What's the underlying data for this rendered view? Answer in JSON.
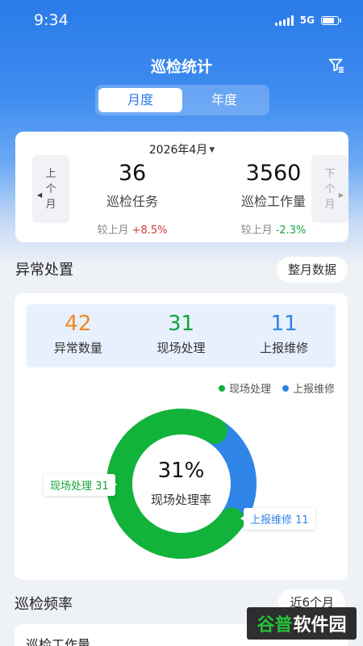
{
  "status": {
    "time": "9:34",
    "network": "5G"
  },
  "header": {
    "title": "巡检统计"
  },
  "segments": [
    {
      "label": "月度"
    },
    {
      "label": "年度"
    }
  ],
  "summary": {
    "month": "2026年4月",
    "prev_label": [
      "上",
      "个",
      "月"
    ],
    "next_label": [
      "下",
      "个",
      "月"
    ],
    "stats": [
      {
        "value": "36",
        "label": "巡检任务",
        "compare_label": "较上月",
        "delta": "+8.5%"
      },
      {
        "value": "3560",
        "label": "巡检工作量",
        "compare_label": "较上月",
        "delta": "-2.3%"
      }
    ]
  },
  "anomaly": {
    "title": "异常处置",
    "range_button": "整月数据",
    "metrics": [
      {
        "value": "42",
        "label": "异常数量",
        "color": "#f08a24"
      },
      {
        "value": "31",
        "label": "现场处理",
        "color": "#12a53a"
      },
      {
        "value": "11",
        "label": "上报维修",
        "color": "#2f84e8"
      }
    ]
  },
  "chart_data": {
    "type": "pie",
    "series": [
      {
        "name": "现场处理",
        "value": 31,
        "color": "#12b33a"
      },
      {
        "name": "上报维修",
        "value": 11,
        "color": "#2f84e8"
      }
    ],
    "center_value": "31%",
    "center_label": "现场处理率",
    "callouts": [
      "现场处理 31",
      "上报维修 11"
    ],
    "legend_position": "top-right"
  },
  "frequency": {
    "title": "巡检频率",
    "range_button": "近6个月",
    "card_title": "巡检工作量"
  },
  "watermark": {
    "part1": "谷普",
    "part2": "软件园"
  }
}
